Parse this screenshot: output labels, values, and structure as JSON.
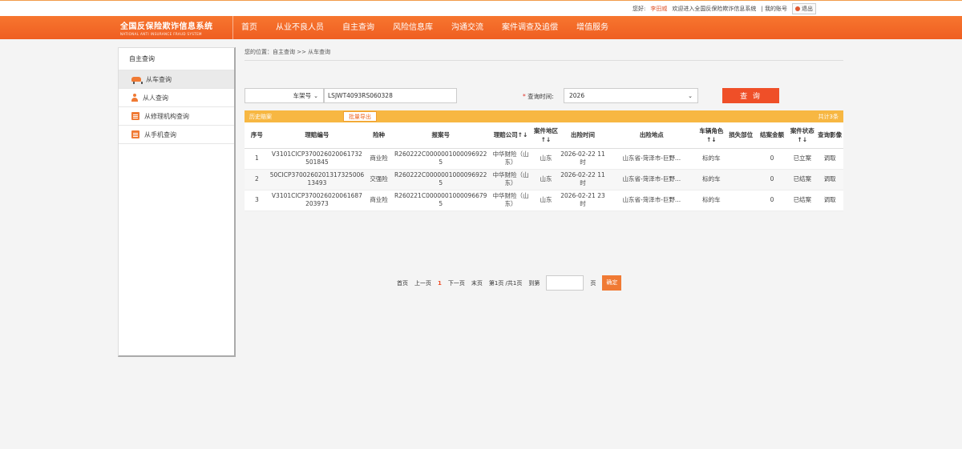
{
  "topbar": {
    "greeting_prefix": "您好:",
    "username": "李田威",
    "welcome": "欢迎进入全国反保险欺诈信息系统",
    "my_account": "| 我的账号",
    "logout": "退出"
  },
  "brand": {
    "title_cn": "全国反保险欺诈信息系统",
    "title_en": "NATIONAL ANTI INSURANCE FRAUD SYSTEM"
  },
  "nav": {
    "items": [
      "首页",
      "从业不良人员",
      "自主查询",
      "风险信息库",
      "沟通交流",
      "案件调查及追偿",
      "增值服务"
    ]
  },
  "sidebar": {
    "title": "自主查询",
    "items": [
      {
        "label": "从车查询",
        "icon": "car-icon"
      },
      {
        "label": "从人查询",
        "icon": "person-icon"
      },
      {
        "label": "从修理机构查询",
        "icon": "document-icon"
      },
      {
        "label": "从手机查询",
        "icon": "document-icon"
      }
    ]
  },
  "breadcrumb": "您的位置：自主查询 >> 从车查询",
  "search": {
    "field_type": "车架号",
    "vin_value": "LSJWT4093RS060328",
    "time_label_required": "*",
    "time_label": "查询时间:",
    "time_value": "2026",
    "query_button": "查 询"
  },
  "results": {
    "title": "历史赔案",
    "export_button": "批量导出",
    "count": "共计3条",
    "columns": [
      "序号",
      "理赔编号",
      "险种",
      "报案号",
      "理赔公司↑↓",
      "案件地区↑↓",
      "出险时间",
      "出险地点",
      "车辆角色↑↓",
      "损失部位",
      "结案金额",
      "案件状态↑↓",
      "查询影像"
    ],
    "rows": [
      [
        "1",
        "V3101CICP370026020061732501845",
        "商业险",
        "R260222C00000010000969225",
        "中华财险（山东）",
        "山东",
        "2026-02-22 11时",
        "山东省-菏泽市-巨野...",
        "标的车",
        "",
        "0",
        "已立案",
        "调取"
      ],
      [
        "2",
        "50CICP370026020131732500613493",
        "交强险",
        "R260222C00000010000969225",
        "中华财险（山东）",
        "山东",
        "2026-02-22 11时",
        "山东省-菏泽市-巨野...",
        "标的车",
        "",
        "0",
        "已结案",
        "调取"
      ],
      [
        "3",
        "V3101CICP370026020061687203973",
        "商业险",
        "R260221C00000010000966795",
        "中华财险（山东）",
        "山东",
        "2026-02-21 23时",
        "山东省-菏泽市-巨野...",
        "标的车",
        "",
        "0",
        "已结案",
        "调取"
      ]
    ]
  },
  "pager": {
    "first": "首页",
    "prev": "上一页",
    "current": "1",
    "next": "下一页",
    "last": "末页",
    "info": "第1页 /共1页",
    "goto": "到第",
    "page_unit": "页",
    "confirm": "确定"
  }
}
